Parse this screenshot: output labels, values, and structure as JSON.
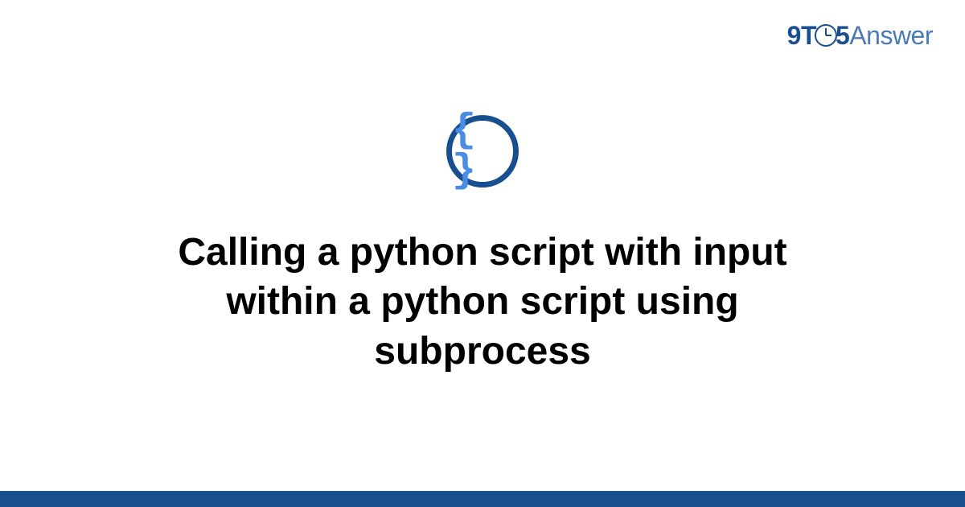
{
  "logo": {
    "part1": "9T",
    "part2": "5",
    "part3": "Answer"
  },
  "icon": {
    "name": "braces-icon",
    "glyph": "{ }"
  },
  "title": "Calling a python script with input within a python script using subprocess",
  "colors": {
    "dark_blue": "#1a4f8f",
    "light_blue": "#4a7bb8",
    "brace_blue": "#4a8de5"
  }
}
